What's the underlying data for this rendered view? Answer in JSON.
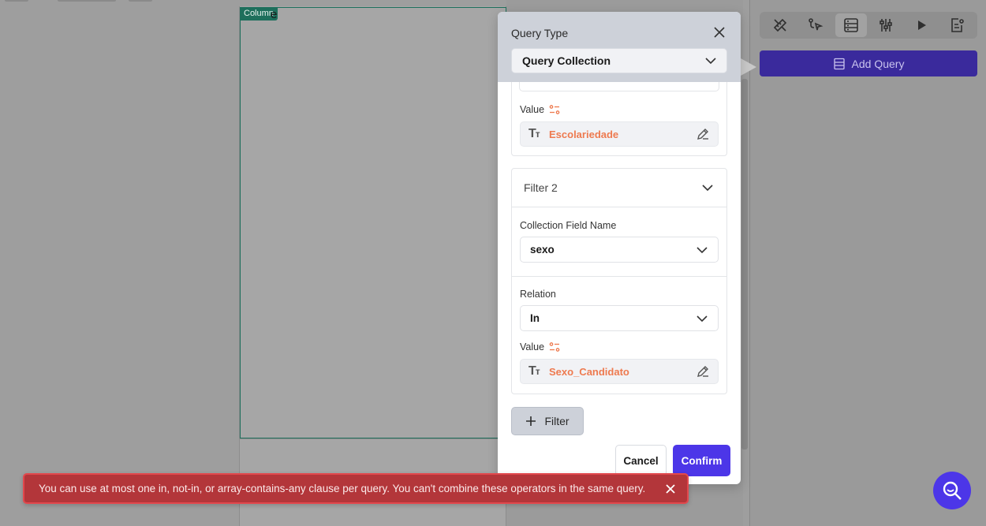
{
  "canvas": {
    "column_tag": "Column",
    "column_text": "e"
  },
  "right_panel": {
    "toolbar_icons": [
      "ruler-pencil-icon",
      "pointer-branch-icon",
      "database-icon",
      "sliders-icon",
      "play-icon",
      "document-settings-icon"
    ],
    "active_tool": "database-icon",
    "add_query_label": "Add Query"
  },
  "popover": {
    "title": "Query Type",
    "query_type_value": "Query Collection",
    "filter1": {
      "value_label": "Value",
      "value_text": "Escolariedade"
    },
    "filter2": {
      "header": "Filter 2",
      "field_name_label": "Collection Field Name",
      "field_name_value": "sexo",
      "relation_label": "Relation",
      "relation_value": "In",
      "value_label": "Value",
      "value_text": "Sexo_Candidato"
    },
    "add_filter_label": "Filter",
    "cancel_label": "Cancel",
    "confirm_label": "Confirm",
    "value_type_glyph": "Tт"
  },
  "toast": {
    "message": "You can use at most one in, not-in, or array-contains-any clause per query. You can't combine these operators in the same query.",
    "color": "#b3363a"
  },
  "colors": {
    "accent": "#4c36e8",
    "bound_value": "#ee7a4f",
    "column_outline": "#1e6f5c"
  }
}
